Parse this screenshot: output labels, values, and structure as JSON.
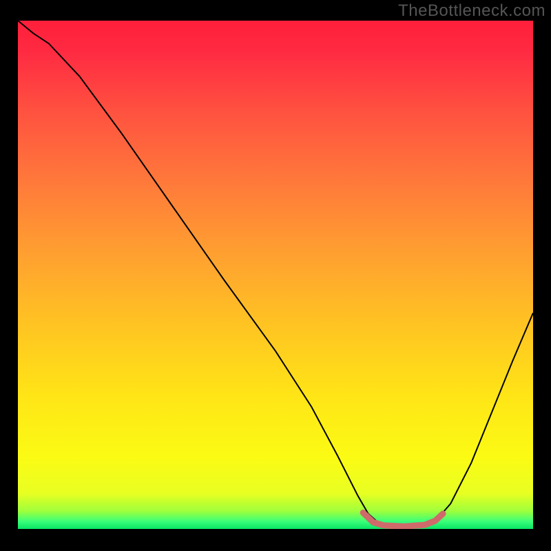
{
  "watermark": "TheBottleneck.com",
  "chart_data": {
    "type": "line",
    "title": "",
    "xlabel": "",
    "ylabel": "",
    "xlim": [
      0,
      100
    ],
    "ylim": [
      0,
      100
    ],
    "gradient_stops": [
      {
        "offset": 0.0,
        "color": "#ff1f3b"
      },
      {
        "offset": 0.06,
        "color": "#ff2a42"
      },
      {
        "offset": 0.18,
        "color": "#ff5240"
      },
      {
        "offset": 0.32,
        "color": "#ff7a3a"
      },
      {
        "offset": 0.46,
        "color": "#ffa030"
      },
      {
        "offset": 0.6,
        "color": "#ffc422"
      },
      {
        "offset": 0.74,
        "color": "#ffe516"
      },
      {
        "offset": 0.86,
        "color": "#fbfb14"
      },
      {
        "offset": 0.93,
        "color": "#e8ff22"
      },
      {
        "offset": 0.965,
        "color": "#9eff3c"
      },
      {
        "offset": 0.985,
        "color": "#3bff79"
      },
      {
        "offset": 1.0,
        "color": "#08e566"
      }
    ],
    "series": [
      {
        "name": "bottleneck-curve",
        "color": "#000000",
        "points": [
          {
            "x": 0.0,
            "y": 100.0
          },
          {
            "x": 3.0,
            "y": 97.5
          },
          {
            "x": 6.0,
            "y": 95.5
          },
          {
            "x": 12.0,
            "y": 89.0
          },
          {
            "x": 20.0,
            "y": 78.0
          },
          {
            "x": 30.0,
            "y": 63.5
          },
          {
            "x": 40.0,
            "y": 49.0
          },
          {
            "x": 50.0,
            "y": 35.0
          },
          {
            "x": 57.0,
            "y": 24.0
          },
          {
            "x": 62.0,
            "y": 14.5
          },
          {
            "x": 66.0,
            "y": 6.5
          },
          {
            "x": 68.0,
            "y": 3.0
          },
          {
            "x": 70.0,
            "y": 1.2
          },
          {
            "x": 73.0,
            "y": 0.5
          },
          {
            "x": 78.0,
            "y": 0.5
          },
          {
            "x": 81.0,
            "y": 1.5
          },
          {
            "x": 84.0,
            "y": 5.0
          },
          {
            "x": 88.0,
            "y": 13.0
          },
          {
            "x": 92.0,
            "y": 23.0
          },
          {
            "x": 96.0,
            "y": 33.0
          },
          {
            "x": 100.0,
            "y": 42.5
          }
        ]
      },
      {
        "name": "optimal-band",
        "color": "#cf6a6a",
        "stroke_width_px": 9,
        "points": [
          {
            "x": 67.0,
            "y": 3.2
          },
          {
            "x": 69.0,
            "y": 1.3
          },
          {
            "x": 71.0,
            "y": 0.7
          },
          {
            "x": 75.0,
            "y": 0.5
          },
          {
            "x": 79.0,
            "y": 0.8
          },
          {
            "x": 81.0,
            "y": 1.6
          },
          {
            "x": 82.5,
            "y": 3.0
          }
        ]
      }
    ]
  }
}
